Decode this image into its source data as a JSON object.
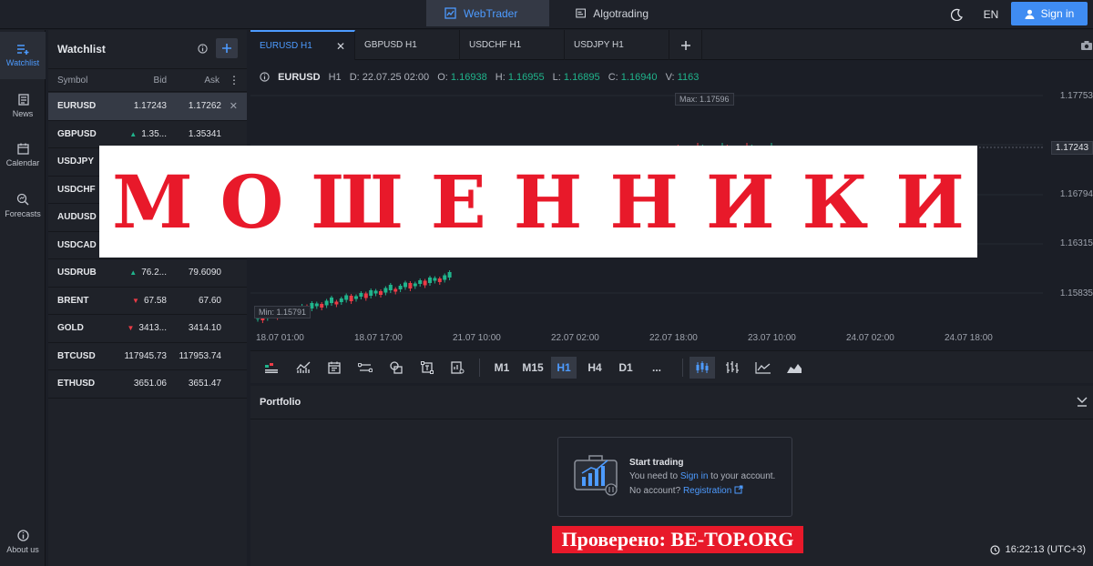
{
  "topbar": {
    "webtrader_label": "WebTrader",
    "algotrading_label": "Algotrading",
    "language": "EN",
    "signin_label": "Sign in"
  },
  "sidebar": {
    "items": [
      {
        "label": "Watchlist",
        "icon": "watchlist-icon"
      },
      {
        "label": "News",
        "icon": "news-icon"
      },
      {
        "label": "Calendar",
        "icon": "calendar-icon"
      },
      {
        "label": "Forecasts",
        "icon": "forecasts-icon"
      }
    ],
    "about_label": "About us"
  },
  "watchlist": {
    "title": "Watchlist",
    "columns": {
      "symbol": "Symbol",
      "bid": "Bid",
      "ask": "Ask"
    },
    "rows": [
      {
        "symbol": "EURUSD",
        "bid": "1.17243",
        "ask": "1.17262",
        "dir": ""
      },
      {
        "symbol": "GBPUSD",
        "bid": "1.35...",
        "ask": "1.35341",
        "dir": "up"
      },
      {
        "symbol": "USDJPY",
        "bid": "",
        "ask": "",
        "dir": ""
      },
      {
        "symbol": "USDCHF",
        "bid": "",
        "ask": "",
        "dir": ""
      },
      {
        "symbol": "AUDUSD",
        "bid": "",
        "ask": "",
        "dir": ""
      },
      {
        "symbol": "USDCAD",
        "bid": "",
        "ask": "",
        "dir": ""
      },
      {
        "symbol": "USDRUB",
        "bid": "76.2...",
        "ask": "79.6090",
        "dir": "up"
      },
      {
        "symbol": "BRENT",
        "bid": "67.58",
        "ask": "67.60",
        "dir": "down"
      },
      {
        "symbol": "GOLD",
        "bid": "3413...",
        "ask": "3414.10",
        "dir": "down"
      },
      {
        "symbol": "BTCUSD",
        "bid": "117945.73",
        "ask": "117953.74",
        "dir": ""
      },
      {
        "symbol": "ETHUSD",
        "bid": "3651.06",
        "ask": "3651.47",
        "dir": ""
      }
    ]
  },
  "chart_tabs": [
    "EURUSD H1",
    "GBPUSD H1",
    "USDCHF H1",
    "USDJPY H1"
  ],
  "ohlc": {
    "symbol": "EURUSD",
    "tf": "H1",
    "date": "D: 22.07.25 02:00",
    "o_label": "O:",
    "o": "1.16938",
    "h_label": "H:",
    "h": "1.16955",
    "l_label": "L:",
    "l": "1.16895",
    "c_label": "C:",
    "c": "1.16940",
    "v_label": "V:",
    "v": "1163"
  },
  "chart": {
    "max_label": "Max: 1.17596",
    "min_label": "Min: 1.15791",
    "y_labels": [
      "1.17753",
      "1.17243",
      "1.16794",
      "1.16315",
      "1.15835"
    ],
    "x_labels": [
      "18.07 01:00",
      "18.07 17:00",
      "21.07 10:00",
      "22.07 02:00",
      "22.07 18:00",
      "23.07 10:00",
      "24.07 02:00",
      "24.07 18:00"
    ]
  },
  "timeframes": [
    "M1",
    "M15",
    "H1",
    "H4",
    "D1",
    "..."
  ],
  "active_timeframe": "H1",
  "portfolio": {
    "title": "Portfolio",
    "card_title": "Start trading",
    "line1_pre": "You need to",
    "line1_link": "Sign in",
    "line1_post": "to your account.",
    "line2_pre": "No account?",
    "line2_link": "Registration"
  },
  "overlay": {
    "text": "МОШЕННИКИ",
    "stamp": "Проверено: BE-TOP.ORG"
  },
  "status": {
    "time": "16:22:13 (UTC+3)"
  },
  "colors": {
    "accent": "#4d9bff",
    "up": "#20b48c",
    "down": "#ec3b46",
    "overlay_red": "#e8192a"
  }
}
